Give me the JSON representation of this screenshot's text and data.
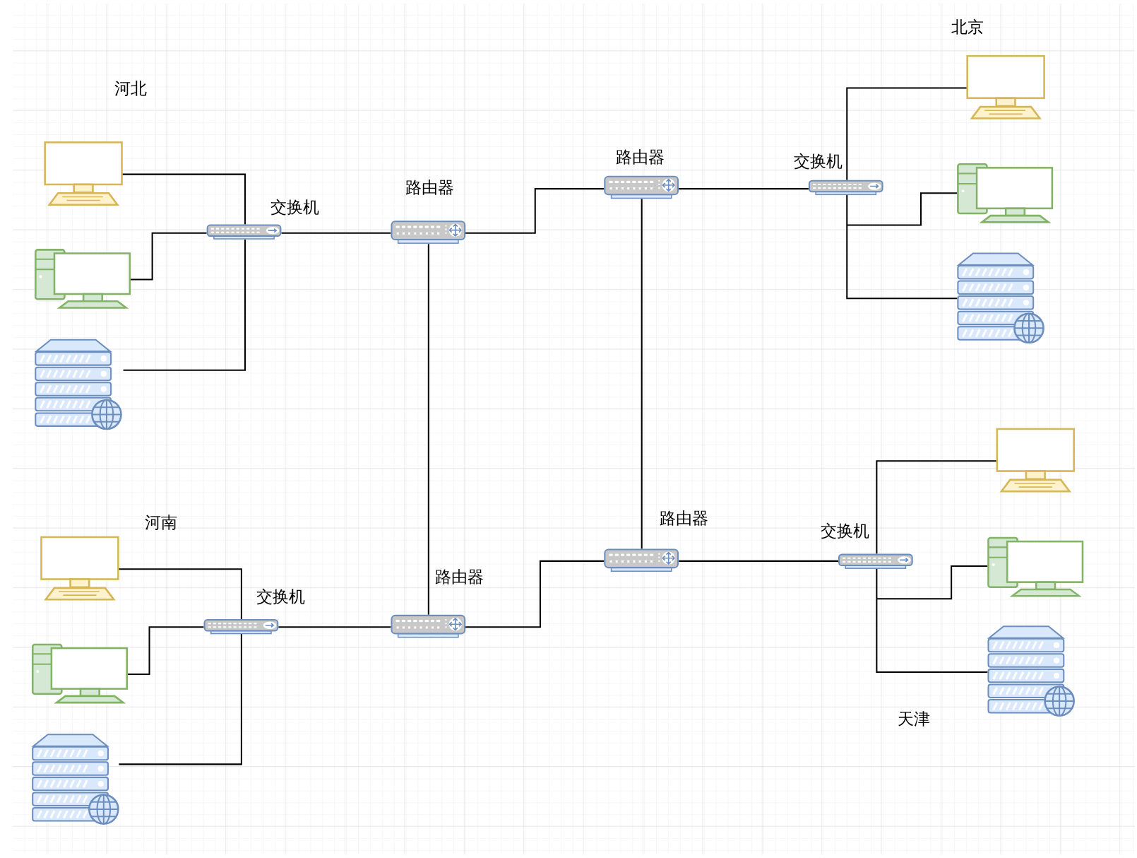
{
  "diagram": {
    "regions": [
      {
        "name": "河北"
      },
      {
        "name": "北京"
      },
      {
        "name": "河南"
      },
      {
        "name": "天津"
      }
    ],
    "nodes": [
      {
        "kind": "monitor"
      },
      {
        "kind": "desktop"
      },
      {
        "kind": "server"
      },
      {
        "kind": "switch",
        "label": "交换机"
      },
      {
        "kind": "router",
        "label": "路由器"
      },
      {
        "kind": "router",
        "label": "路由器"
      },
      {
        "kind": "switch",
        "label": "交换机"
      },
      {
        "kind": "monitor"
      },
      {
        "kind": "desktop"
      },
      {
        "kind": "server"
      },
      {
        "kind": "monitor"
      },
      {
        "kind": "desktop"
      },
      {
        "kind": "server"
      },
      {
        "kind": "switch",
        "label": "交换机"
      },
      {
        "kind": "router",
        "label": "路由器"
      },
      {
        "kind": "router",
        "label": "路由器"
      },
      {
        "kind": "switch",
        "label": "交换机"
      },
      {
        "kind": "monitor"
      },
      {
        "kind": "desktop"
      },
      {
        "kind": "server"
      }
    ]
  }
}
